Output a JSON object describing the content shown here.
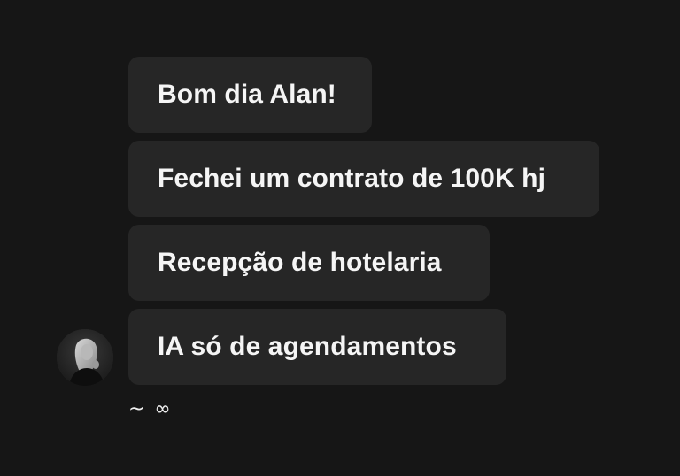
{
  "messages": [
    {
      "text": "Bom dia Alan!"
    },
    {
      "text": "Fechei um contrato de 100K hj"
    },
    {
      "text": "Recepção de hotelaria"
    },
    {
      "text": "IA só de agendamentos"
    }
  ],
  "sender": {
    "avatar_icon": "user-photo-avatar"
  },
  "reaction_line": "~ ∞",
  "colors": {
    "background": "#161616",
    "bubble": "#262626",
    "text": "#f5f5f5"
  }
}
